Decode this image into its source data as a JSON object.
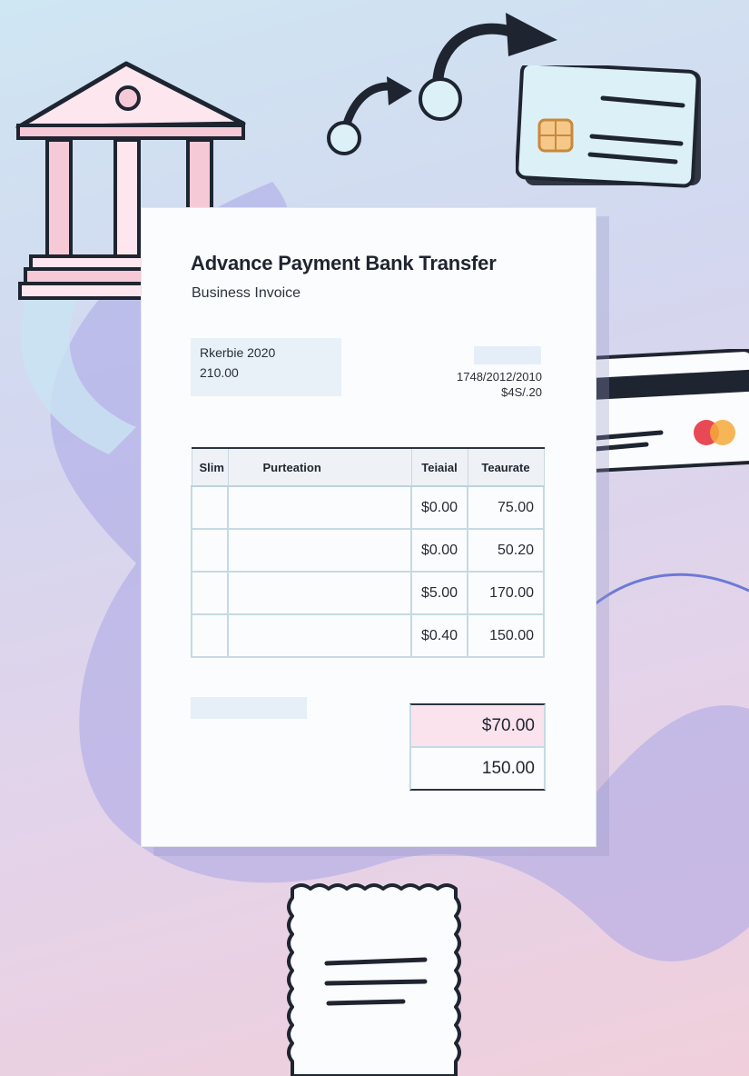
{
  "invoice": {
    "title": "Advance Payment Bank Transfer",
    "subtitle": "Business Invoice",
    "info": {
      "line1": "Rkerbie 2020",
      "line2": "210.00"
    },
    "reference": {
      "line1": "1748/2012/2010",
      "line2": "$4S/.20"
    },
    "table": {
      "headers": [
        "Slim",
        "Purteation",
        "Teiaial",
        "Teaurate"
      ],
      "rows": [
        [
          "",
          "",
          "$0.00",
          "75.00"
        ],
        [
          "",
          "",
          "$0.00",
          "50.20"
        ],
        [
          "",
          "",
          "$5.00",
          "170.00"
        ],
        [
          "",
          "",
          "$0.40",
          "150.00"
        ]
      ]
    },
    "totals": {
      "first": "$70.00",
      "second": "150.00"
    }
  },
  "colors": {
    "background_top": "#cfe6f3",
    "background_bottom": "#f0cfdb",
    "swirl": "#a9a6e6",
    "bank_pink": "#f6c9d6",
    "card_blue": "#dcf0f8",
    "highlight_pink": "#fbe3ee",
    "ink": "#1e2530"
  },
  "icons": [
    "bank-icon",
    "transfer-arrow-icon",
    "chip-card-icon",
    "credit-card-icon",
    "receipt-icon"
  ]
}
